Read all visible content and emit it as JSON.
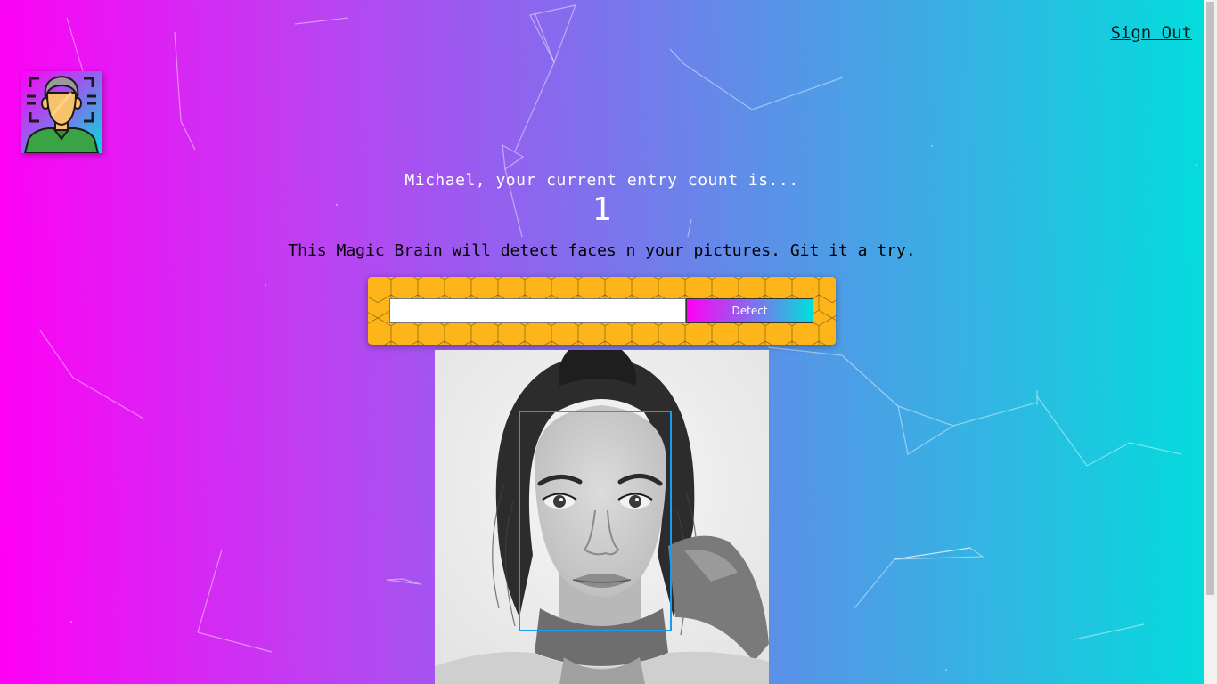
{
  "nav": {
    "signout_label": "Sign Out"
  },
  "logo": {
    "icon": "face-recognition-icon"
  },
  "rank": {
    "message": "Michael, your current entry count is...",
    "count": "1"
  },
  "intro": {
    "text": "This Magic Brain will detect faces n your pictures. Git it a try."
  },
  "form": {
    "input_value": "",
    "input_placeholder": "",
    "detect_label": "Detect"
  },
  "result": {
    "image": "face-photo",
    "face_detections": 1
  },
  "colors": {
    "gradient_start": "#ff00f5",
    "gradient_mid": "#8a68ee",
    "gradient_end": "#00dfdc",
    "panel": "#fdb51a",
    "face_box": "#149df2"
  }
}
